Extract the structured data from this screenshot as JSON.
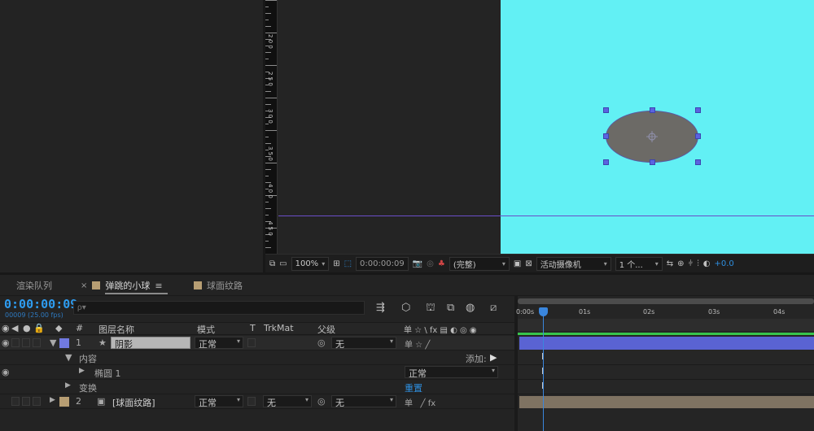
{
  "viewer": {
    "ruler_labels": [
      "0",
      "0",
      "0",
      "0",
      "0",
      "0",
      "0",
      "0"
    ],
    "ruler_labels_full": [
      "2 0 0",
      "2 5 0",
      "3 0 0",
      "3 5 0",
      "4 0 0",
      "4 5 0"
    ],
    "zoom": "100%",
    "timecode": "0:00:00:09",
    "resolution": "(完整)",
    "camera": "活动摄像机",
    "views": "1 个...",
    "exposure": "+0.0"
  },
  "tabs": {
    "render_queue": "渲染队列",
    "comp_active": "弹跳的小球",
    "comp_other": "球面纹路",
    "comp_active_color": "#b79e73",
    "comp_other_color": "#b79e73"
  },
  "timeline": {
    "timecode": "0:00:00:09",
    "fps": "00009 (25.00 fps)",
    "search_placeholder": "ρ▾",
    "ruler": [
      "0:00s",
      "01s",
      "02s",
      "03s",
      "04s"
    ]
  },
  "columns": {
    "hash": "#",
    "layer_name": "图层名称",
    "mode": "模式",
    "t": "T",
    "trkmat": "TrkMat",
    "parent": "父级",
    "switches": "单 ☆ \\ fx ▤ ◐ ◎ ◉"
  },
  "layers": [
    {
      "index": "1",
      "name": "阴影",
      "mode": "正常",
      "parent": "无",
      "color": "#7079e0"
    },
    {
      "index": "2",
      "name": "[球面纹路]",
      "mode": "正常",
      "trkmat": "无",
      "parent": "无",
      "color": "#b79e73"
    }
  ],
  "sub": {
    "contents": "内容",
    "add_label": "添加:",
    "ellipse": "椭圆 1",
    "ellipse_mode": "正常",
    "transform": "变换",
    "reset": "重置"
  }
}
